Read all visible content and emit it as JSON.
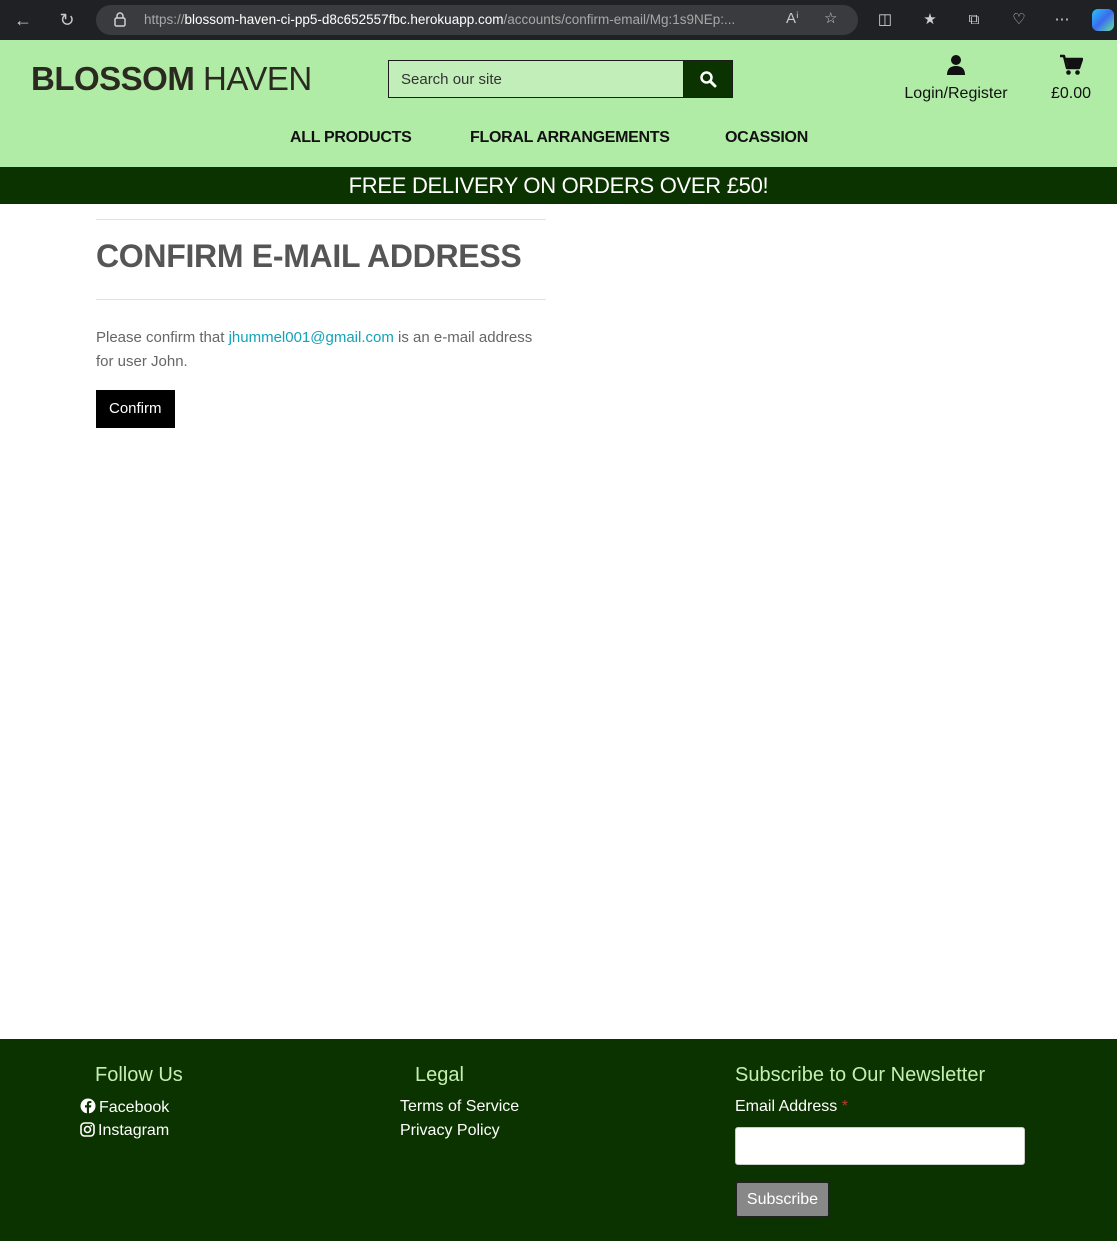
{
  "browser": {
    "url_prefix": "https://",
    "url_host": "blossom-haven-ci-pp5-d8c652557fbc.herokuapp.com",
    "url_path": "/accounts/confirm-email/Mg:1s9NEp:..."
  },
  "header": {
    "logo_bold": "BLOSSOM",
    "logo_light": "HAVEN",
    "search_placeholder": "Search our site",
    "account_label": "Login/Register",
    "cart_total": "£0.00"
  },
  "menu": {
    "items": [
      "ALL PRODUCTS",
      "FLORAL ARRANGEMENTS",
      "OCASSION"
    ]
  },
  "banner": "FREE DELIVERY ON ORDERS OVER £50!",
  "main": {
    "title": "CONFIRM E-MAIL ADDRESS",
    "message_before": "Please confirm that ",
    "email": "jhummel001@gmail.com",
    "message_after": " is an e-mail address for user John.",
    "confirm_label": "Confirm"
  },
  "footer": {
    "follow_heading": "Follow Us",
    "facebook": "Facebook",
    "instagram": "Instagram",
    "legal_heading": "Legal",
    "terms": "Terms of Service",
    "privacy": "Privacy Policy",
    "newsletter_heading": "Subscribe to Our Newsletter",
    "email_label": "Email Address",
    "required_mark": "*",
    "subscribe_label": "Subscribe"
  },
  "colors": {
    "header_bg": "#b1eca6",
    "dark_green": "#0b3300",
    "link": "#14a2b8"
  }
}
